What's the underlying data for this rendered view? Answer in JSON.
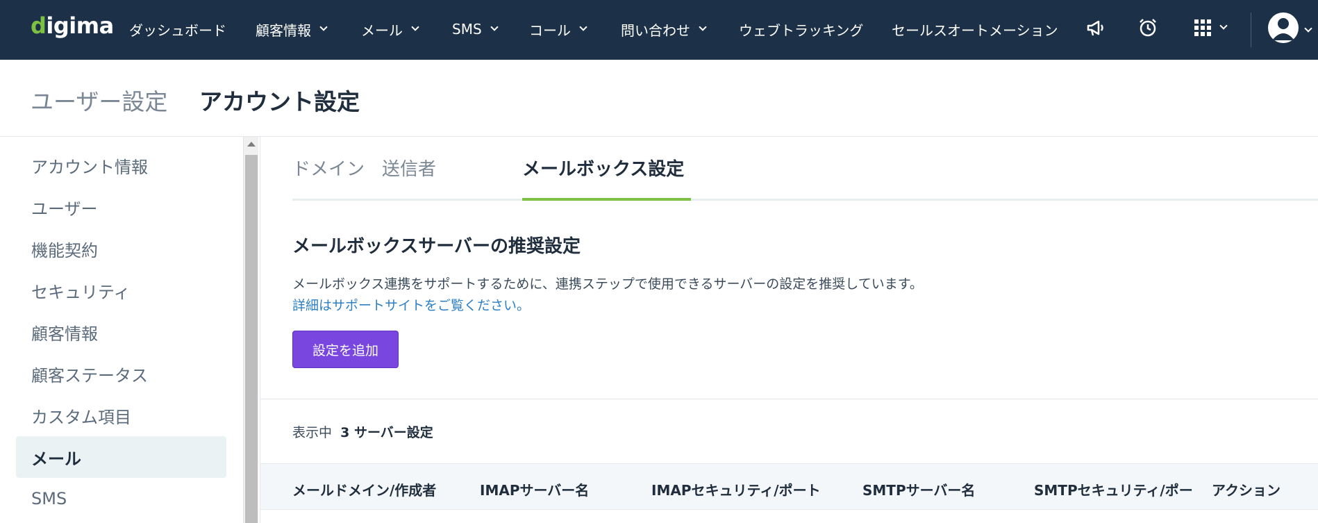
{
  "app": {
    "logo_prefix": "d",
    "logo_rest": "igima"
  },
  "nav": {
    "items": [
      {
        "label": "ダッシュボード"
      },
      {
        "label": "顧客情報"
      },
      {
        "label": "メール"
      },
      {
        "label": "SMS"
      },
      {
        "label": "コール"
      },
      {
        "label": "問い合わせ"
      },
      {
        "label": "ウェブトラッキング"
      },
      {
        "label": "セールスオートメーション"
      }
    ],
    "icons": [
      "megaphone-icon",
      "alarm-clock-icon",
      "apps-grid-icon",
      "user-avatar-icon"
    ]
  },
  "page": {
    "breadcrumb_parent": "ユーザー設定",
    "title": "アカウント設定"
  },
  "sidebar": {
    "items": [
      {
        "label": "アカウント情報"
      },
      {
        "label": "ユーザー"
      },
      {
        "label": "機能契約"
      },
      {
        "label": "セキュリティ"
      },
      {
        "label": "顧客情報"
      },
      {
        "label": "顧客ステータス"
      },
      {
        "label": "カスタム項目"
      },
      {
        "label": "メール",
        "active": true
      },
      {
        "label": "SMS"
      }
    ]
  },
  "tabs": [
    {
      "label": "ドメイン"
    },
    {
      "label": "送信者"
    },
    {
      "label": "メールボックス設定",
      "active": true
    }
  ],
  "section": {
    "title": "メールボックスサーバーの推奨設定",
    "description": "メールボックス連携をサポートするために、連携ステップで使用できるサーバーの設定を推奨しています。",
    "link": "詳細はサポートサイトをご覧ください。",
    "add_button": "設定を追加"
  },
  "listing": {
    "prefix": "表示中",
    "count_text": "3 サーバー設定"
  },
  "table": {
    "columns": [
      "メールドメイン/作成者",
      "IMAPサーバー名",
      "IMAPセキュリティ/ポート",
      "SMTPサーバー名",
      "SMTPセキュリティ/ポート",
      "アクション"
    ]
  },
  "colors": {
    "nav_bg": "#1c3148",
    "brand_green": "#7cc142",
    "accent_purple": "#7a46e0",
    "link_blue": "#2d7fc4"
  }
}
